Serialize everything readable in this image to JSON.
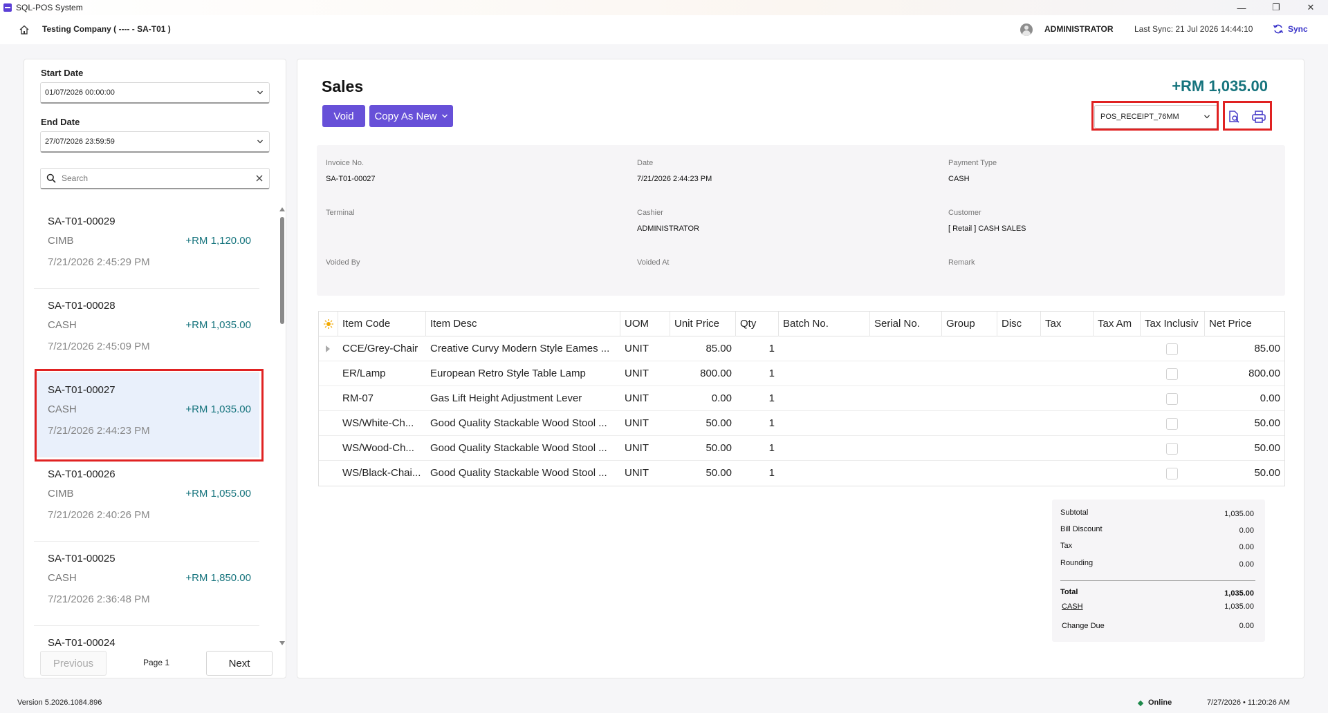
{
  "window": {
    "title": "SQL-POS System",
    "minimize": "—",
    "maximize": "❐",
    "close": "✕"
  },
  "header": {
    "company": "Testing Company ( ---- - SA-T01 )",
    "user": "ADMINISTRATOR",
    "last_sync": "Last Sync: 21 Jul 2026 14:44:10",
    "sync_label": "Sync"
  },
  "filters": {
    "start_date_label": "Start Date",
    "start_date_value": "01/07/2026 00:00:00",
    "end_date_label": "End Date",
    "end_date_value": "27/07/2026 23:59:59",
    "search_placeholder": "Search"
  },
  "sales_list": [
    {
      "no": "SA-T01-00029",
      "payment": "CIMB",
      "amount": "+RM 1,120.00",
      "date": "7/21/2026 2:45:29 PM",
      "selected": false
    },
    {
      "no": "SA-T01-00028",
      "payment": "CASH",
      "amount": "+RM 1,035.00",
      "date": "7/21/2026 2:45:09 PM",
      "selected": false
    },
    {
      "no": "SA-T01-00027",
      "payment": "CASH",
      "amount": "+RM 1,035.00",
      "date": "7/21/2026 2:44:23 PM",
      "selected": true
    },
    {
      "no": "SA-T01-00026",
      "payment": "CIMB",
      "amount": "+RM 1,055.00",
      "date": "7/21/2026 2:40:26 PM",
      "selected": false
    },
    {
      "no": "SA-T01-00025",
      "payment": "CASH",
      "amount": "+RM 1,850.00",
      "date": "7/21/2026 2:36:48 PM",
      "selected": false
    },
    {
      "no": "SA-T01-00024",
      "payment": "",
      "amount": "",
      "date": "",
      "selected": false
    }
  ],
  "pager": {
    "previous": "Previous",
    "page": "Page 1",
    "next": "Next"
  },
  "detail": {
    "title": "Sales",
    "total": "+RM 1,035.00",
    "void_label": "Void",
    "copy_label": "Copy As New",
    "template": "POS_RECEIPT_76MM",
    "info": {
      "invoice_no_label": "Invoice No.",
      "invoice_no": "SA-T01-00027",
      "date_label": "Date",
      "date": "7/21/2026 2:44:23 PM",
      "payment_type_label": "Payment Type",
      "payment_type": "CASH",
      "terminal_label": "Terminal",
      "terminal": "",
      "cashier_label": "Cashier",
      "cashier": "ADMINISTRATOR",
      "customer_label": "Customer",
      "customer": "[ Retail ] CASH SALES",
      "voided_by_label": "Voided By",
      "voided_at_label": "Voided At",
      "remark_label": "Remark"
    }
  },
  "table": {
    "columns": [
      "Item Code",
      "Item Desc",
      "UOM",
      "Unit Price",
      "Qty",
      "Batch No.",
      "Serial No.",
      "Group",
      "Disc",
      "Tax",
      "Tax Am",
      "Tax Inclusiv",
      "Net Price"
    ],
    "rows": [
      {
        "code": "CCE/Grey-Chair",
        "desc": "Creative Curvy Modern Style Eames ...",
        "uom": "UNIT",
        "unit_price": "85.00",
        "qty": "1",
        "net": "85.00"
      },
      {
        "code": "ER/Lamp",
        "desc": "European Retro Style Table Lamp",
        "uom": "UNIT",
        "unit_price": "800.00",
        "qty": "1",
        "net": "800.00"
      },
      {
        "code": "RM-07",
        "desc": "Gas Lift Height Adjustment Lever",
        "uom": "UNIT",
        "unit_price": "0.00",
        "qty": "1",
        "net": "0.00"
      },
      {
        "code": "WS/White-Ch...",
        "desc": "Good Quality Stackable Wood Stool ...",
        "uom": "UNIT",
        "unit_price": "50.00",
        "qty": "1",
        "net": "50.00"
      },
      {
        "code": "WS/Wood-Ch...",
        "desc": "Good Quality Stackable Wood Stool ...",
        "uom": "UNIT",
        "unit_price": "50.00",
        "qty": "1",
        "net": "50.00"
      },
      {
        "code": "WS/Black-Chai...",
        "desc": "Good Quality Stackable Wood Stool ...",
        "uom": "UNIT",
        "unit_price": "50.00",
        "qty": "1",
        "net": "50.00"
      }
    ]
  },
  "summary": {
    "subtotal_label": "Subtotal",
    "subtotal": "1,035.00",
    "bill_discount_label": "Bill Discount",
    "bill_discount": "0.00",
    "tax_label": "Tax",
    "tax": "0.00",
    "rounding_label": "Rounding",
    "rounding": "0.00",
    "total_label": "Total",
    "total": "1,035.00",
    "cash_label": "CASH",
    "cash": "1,035.00",
    "change_due_label": "Change Due",
    "change_due": "0.00"
  },
  "footer": {
    "version": "Version 5.2026.1084.896",
    "status": "Online",
    "clock": "7/27/2026 • 11:20:26 AM"
  },
  "colors": {
    "accent": "#6750d8",
    "amount": "#16747d",
    "highlight": "#e02222",
    "selected_row": "#e9f0fb"
  },
  "icons": [
    "app-icon",
    "home-icon",
    "avatar",
    "sync-icon",
    "chevron-down-icon",
    "search-icon",
    "close-icon",
    "print-preview-icon",
    "printer-icon",
    "sun-icon",
    "expand-arrow-icon"
  ]
}
